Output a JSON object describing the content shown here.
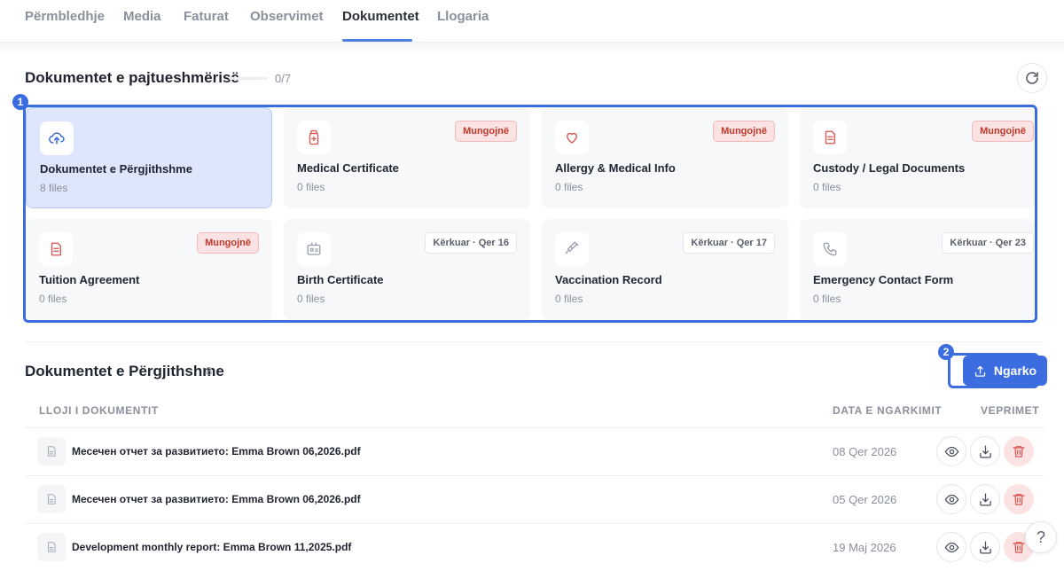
{
  "tabs": [
    {
      "label": "Përmbledhje"
    },
    {
      "label": "Media"
    },
    {
      "label": "Faturat"
    },
    {
      "label": "Observimet"
    },
    {
      "label": "Dokumentet",
      "active": true
    },
    {
      "label": "Llogaria"
    }
  ],
  "compliance": {
    "title": "Dokumentet e pajtueshmërisë",
    "progress": "0/7",
    "progress_fraction": 0,
    "highlight_badge": "1",
    "cards": [
      {
        "title": "Dokumentet e Përgjithshme",
        "sub": "8 files",
        "icon": "cloud-upload-icon",
        "selected": true
      },
      {
        "title": "Medical Certificate",
        "sub": "0 files",
        "icon": "medical-bottle-icon",
        "tag": "Mungojnë"
      },
      {
        "title": "Allergy & Medical Info",
        "sub": "0 files",
        "icon": "heart-icon",
        "tag": "Mungojnë"
      },
      {
        "title": "Custody / Legal Documents",
        "sub": "0 files",
        "icon": "document-icon",
        "tag": "Mungojnë"
      },
      {
        "title": "Tuition Agreement",
        "sub": "0 files",
        "icon": "document-icon",
        "tag": "Mungojnë"
      },
      {
        "title": "Birth Certificate",
        "sub": "0 files",
        "icon": "id-card-icon",
        "tag": "Kërkuar · Qer 16"
      },
      {
        "title": "Vaccination Record",
        "sub": "0 files",
        "icon": "syringe-icon",
        "tag": "Kërkuar · Qer 17"
      },
      {
        "title": "Emergency Contact Form",
        "sub": "0 files",
        "icon": "phone-icon",
        "tag": "Kërkuar · Qer 23"
      }
    ]
  },
  "general": {
    "title": "Dokumentet e Përgjithshme",
    "count": "8",
    "highlight_badge": "2",
    "upload_label": "Ngarko",
    "columns": {
      "type": "LLOJI I DOKUMENTIT",
      "date": "DATA E NGARKIMIT",
      "actions": "VEPRIMET"
    },
    "rows": [
      {
        "name": "Месечен отчет за развитието: Emma Brown 06,2026.pdf",
        "date": "08 Qer 2026"
      },
      {
        "name": "Месечен отчет за развитието: Emma Brown 06,2026.pdf",
        "date": "05 Qer 2026"
      },
      {
        "name": "Development monthly report: Emma Brown 11,2025.pdf",
        "date": "19 Maj 2026"
      }
    ]
  },
  "help": {
    "label": "?"
  },
  "colors": {
    "accent": "#3b6ce0",
    "missing": "#c0392b",
    "missing_bg": "#fbe3e3"
  }
}
